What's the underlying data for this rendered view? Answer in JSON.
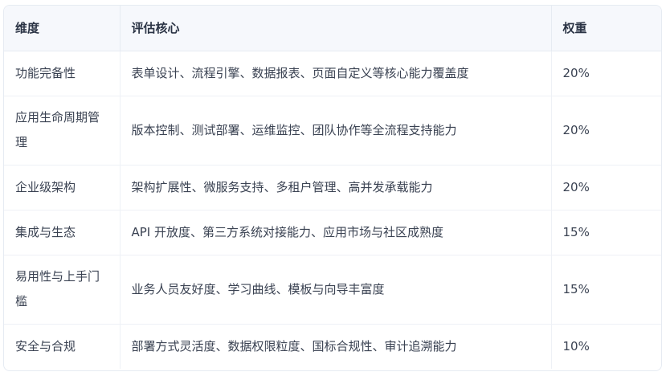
{
  "table": {
    "headers": [
      "维度",
      "评估核心",
      "权重"
    ],
    "rows": [
      {
        "dimension": "功能完备性",
        "core": "表单设计、流程引擎、数据报表、页面自定义等核心能力覆盖度",
        "weight": "20%"
      },
      {
        "dimension": "应用生命周期管理",
        "core": "版本控制、测试部署、运维监控、团队协作等全流程支持能力",
        "weight": "20%"
      },
      {
        "dimension": "企业级架构",
        "core": "架构扩展性、微服务支持、多租户管理、高并发承载能力",
        "weight": "20%"
      },
      {
        "dimension": "集成与生态",
        "core": "API 开放度、第三方系统对接能力、应用市场与社区成熟度",
        "weight": "15%"
      },
      {
        "dimension": "易用性与上手门槛",
        "core": "业务人员友好度、学习曲线、模板与向导丰富度",
        "weight": "15%"
      },
      {
        "dimension": "安全与合规",
        "core": "部署方式灵活度、数据权限粒度、国标合规性、审计追溯能力",
        "weight": "10%"
      }
    ]
  }
}
